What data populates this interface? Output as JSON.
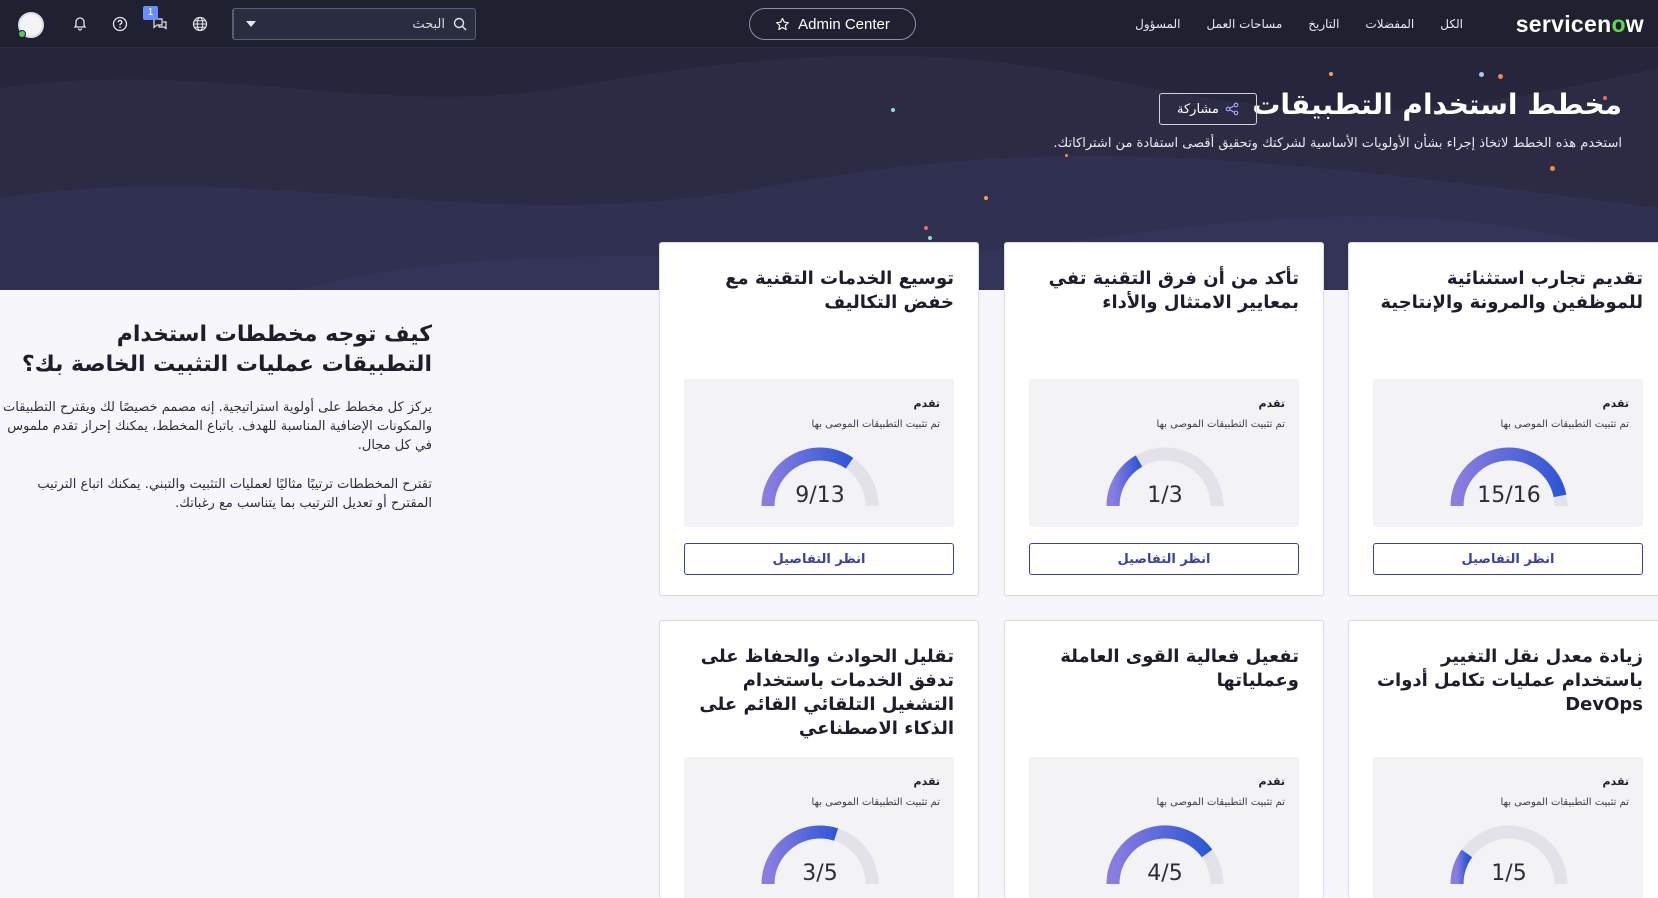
{
  "nav": {
    "logo_text_pre": "servicen",
    "logo_o": "o",
    "logo_text_post": "w",
    "menu": [
      "الكل",
      "المفضلات",
      "التاريخ",
      "مساحات العمل",
      "المسؤول"
    ],
    "admin_center": "Admin Center",
    "search_placeholder": "البحث",
    "chat_badge": "1"
  },
  "hero": {
    "title": "مخطط استخدام التطبيقات",
    "subtitle": "استخدم هذه الخطط لاتخاذ إجراء بشأن الأولويات الأساسية لشركتك وتحقيق أقصى استفادة من اشتراكاتك.",
    "share_label": "مشاركة"
  },
  "info": {
    "title": "كيف توجه مخططات استخدام التطبيقات عمليات التثبيت الخاصة بك؟",
    "p1": "يركز كل مخطط على أولوية استراتيجية. إنه مصمم خصيصًا لك ويقترح التطبيقات والمكونات الإضافية المناسبة للهدف. باتباع المخطط، يمكنك إحراز تقدم ملموس في كل مجال.",
    "p2": "تقترح المخططات ترتيبًا مثاليًا لعمليات التثبيت والتبني. يمكنك اتباع الترتيب المقترح أو تعديل الترتيب بما يتناسب مع رغباتك."
  },
  "cards": [
    {
      "title": "تقديم تجارب استثنائية للموظفين والمرونة والإنتاجية",
      "progress_label": "تقدم",
      "progress_sub": "تم تثبيت التطبيقات الموصى بها",
      "value_text": "15/16",
      "installed": 15,
      "total": 16,
      "button": "انظر التفاصيل"
    },
    {
      "title": "تأكد من أن فرق التقنية تفي بمعايير الامتثال والأداء",
      "progress_label": "تقدم",
      "progress_sub": "تم تثبيت التطبيقات الموصى بها",
      "value_text": "1/3",
      "installed": 1,
      "total": 3,
      "button": "انظر التفاصيل"
    },
    {
      "title": "توسيع الخدمات التقنية مع خفض التكاليف",
      "progress_label": "تقدم",
      "progress_sub": "تم تثبيت التطبيقات الموصى بها",
      "value_text": "9/13",
      "installed": 9,
      "total": 13,
      "button": "انظر التفاصيل"
    },
    {
      "title": "زيادة معدل نقل التغيير باستخدام عمليات تكامل أدوات DevOps",
      "progress_label": "تقدم",
      "progress_sub": "تم تثبيت التطبيقات الموصى بها",
      "value_text": "1/5",
      "installed": 1,
      "total": 5,
      "button": ""
    },
    {
      "title": "تفعيل فعالية القوى العاملة وعملياتها",
      "progress_label": "تقدم",
      "progress_sub": "تم تثبيت التطبيقات الموصى بها",
      "value_text": "4/5",
      "installed": 4,
      "total": 5,
      "button": ""
    },
    {
      "title": "تقليل الحوادث والحفاظ على تدفق الخدمات باستخدام التشغيل التلقائي القائم على الذكاء الاصطناعي",
      "progress_label": "تقدم",
      "progress_sub": "تم تثبيت التطبيقات الموصى بها",
      "value_text": "3/5",
      "installed": 3,
      "total": 5,
      "button": ""
    }
  ],
  "colors": {
    "nav_bg": "#1f2030",
    "hero_bg": "#2b2c44",
    "accent": "#3b40a8",
    "gauge_start": "#8a7de0",
    "gauge_end": "#2e57d6",
    "gauge_track": "#e2e2e8",
    "logo_o": "#62d84e"
  }
}
